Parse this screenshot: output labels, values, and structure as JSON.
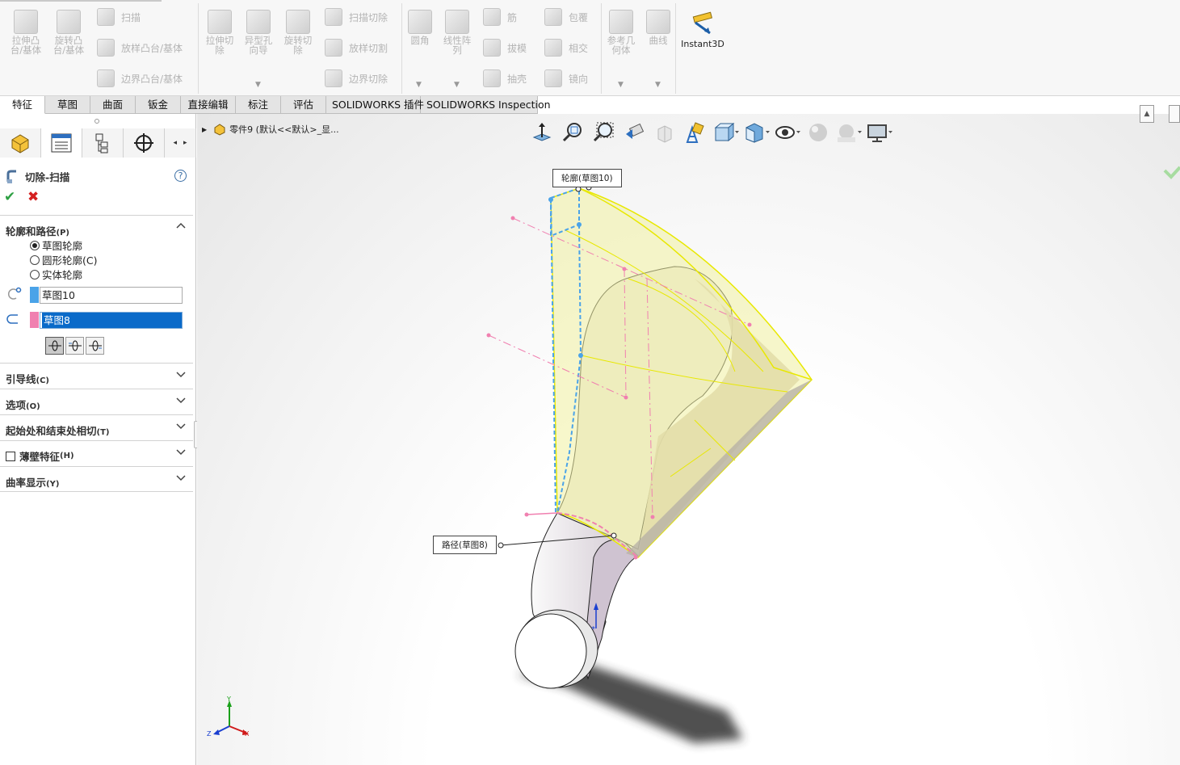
{
  "ribbon": {
    "extrude_boss": "拉伸凸\n台/基体",
    "revolve_boss": "旋转凸\n台/基体",
    "sweep": "扫描",
    "loft": "放样凸台/基体",
    "boundary_boss": "边界凸台/基体",
    "extrude_cut": "拉伸切\n除",
    "hole_wizard": "异型孔\n向导",
    "revolve_cut": "旋转切\n除",
    "swept_cut": "扫描切除",
    "lofted_cut": "放样切割",
    "boundary_cut": "边界切除",
    "fillet": "圆角",
    "linear_pattern": "线性阵\n列",
    "rib": "筋",
    "draft": "拔模",
    "shell": "抽壳",
    "wrap": "包覆",
    "intersect": "相交",
    "mirror": "镜向",
    "ref_geometry": "参考几\n何体",
    "curves": "曲线",
    "instant3d": "Instant3D"
  },
  "tabs": [
    "特征",
    "草图",
    "曲面",
    "钣金",
    "直接编辑",
    "标注",
    "评估",
    "SOLIDWORKS 插件",
    "SOLIDWORKS Inspection"
  ],
  "active_tab": "特征",
  "property_manager": {
    "title": "切除-扫描",
    "help": "?",
    "section_profile": "轮廓和路径",
    "section_profile_key": "(P)",
    "radio_sketch": "草图轮廓",
    "radio_circle": "圆形轮廓(C)",
    "radio_solid": "实体轮廓",
    "profile_value": "草图10",
    "path_value": "草图8",
    "section_guides": "引导线",
    "section_guides_key": "(C)",
    "section_options": "选项",
    "section_options_key": "(O)",
    "section_tangency": "起始处和结束处相切",
    "section_tangency_key": "(T)",
    "section_thin": "薄壁特征",
    "section_thin_key": "(H)",
    "section_curvature": "曲率显示",
    "section_curvature_key": "(Y)"
  },
  "tree": {
    "label": "零件9  (默认<<默认>_显..."
  },
  "viewport": {
    "callout_profile": "轮廓(草图10)",
    "callout_path": "路径(草图8)",
    "triad_y": "Y",
    "triad_x": "X",
    "triad_z": "Z"
  },
  "colors": {
    "profile": "#4aa3e8",
    "path": "#f080b0",
    "selection": "#0a6ac9",
    "preview": "#f1f1a0"
  }
}
